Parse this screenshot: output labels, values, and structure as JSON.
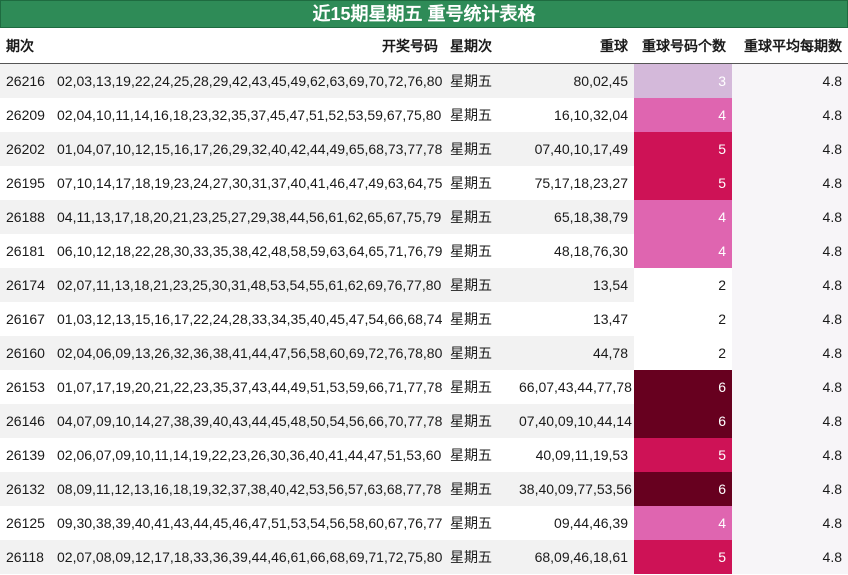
{
  "title": "近15期星期五 重号统计表格",
  "headers": {
    "period": "期次",
    "numbers": "开奖号码",
    "weekday": "星期次",
    "repeat": "重球",
    "repeat_count": "重球号码个数",
    "avg": "重球平均每期数"
  },
  "count_colors": {
    "2": "#ffffff",
    "3": "#d4b9da",
    "4": "#df65b0",
    "5": "#ce1256",
    "6": "#67001f"
  },
  "rows": [
    {
      "period": "26216",
      "numbers": "02,03,13,19,22,24,25,28,29,42,43,45,49,62,63,69,70,72,76,80",
      "weekday": "星期五",
      "repeat": "80,02,45",
      "count": "3",
      "avg": "4.8"
    },
    {
      "period": "26209",
      "numbers": "02,04,10,11,14,16,18,23,32,35,37,45,47,51,52,53,59,67,75,80",
      "weekday": "星期五",
      "repeat": "16,10,32,04",
      "count": "4",
      "avg": "4.8"
    },
    {
      "period": "26202",
      "numbers": "01,04,07,10,12,15,16,17,26,29,32,40,42,44,49,65,68,73,77,78",
      "weekday": "星期五",
      "repeat": "07,40,10,17,49",
      "count": "5",
      "avg": "4.8"
    },
    {
      "period": "26195",
      "numbers": "07,10,14,17,18,19,23,24,27,30,31,37,40,41,46,47,49,63,64,75",
      "weekday": "星期五",
      "repeat": "75,17,18,23,27",
      "count": "5",
      "avg": "4.8"
    },
    {
      "period": "26188",
      "numbers": "04,11,13,17,18,20,21,23,25,27,29,38,44,56,61,62,65,67,75,79",
      "weekday": "星期五",
      "repeat": "65,18,38,79",
      "count": "4",
      "avg": "4.8"
    },
    {
      "period": "26181",
      "numbers": "06,10,12,18,22,28,30,33,35,38,42,48,58,59,63,64,65,71,76,79",
      "weekday": "星期五",
      "repeat": "48,18,76,30",
      "count": "4",
      "avg": "4.8"
    },
    {
      "period": "26174",
      "numbers": "02,07,11,13,18,21,23,25,30,31,48,53,54,55,61,62,69,76,77,80",
      "weekday": "星期五",
      "repeat": "13,54",
      "count": "2",
      "avg": "4.8"
    },
    {
      "period": "26167",
      "numbers": "01,03,12,13,15,16,17,22,24,28,33,34,35,40,45,47,54,66,68,74",
      "weekday": "星期五",
      "repeat": "13,47",
      "count": "2",
      "avg": "4.8"
    },
    {
      "period": "26160",
      "numbers": "02,04,06,09,13,26,32,36,38,41,44,47,56,58,60,69,72,76,78,80",
      "weekday": "星期五",
      "repeat": "44,78",
      "count": "2",
      "avg": "4.8"
    },
    {
      "period": "26153",
      "numbers": "01,07,17,19,20,21,22,23,35,37,43,44,49,51,53,59,66,71,77,78",
      "weekday": "星期五",
      "repeat": "66,07,43,44,77,78",
      "count": "6",
      "avg": "4.8"
    },
    {
      "period": "26146",
      "numbers": "04,07,09,10,14,27,38,39,40,43,44,45,48,50,54,56,66,70,77,78",
      "weekday": "星期五",
      "repeat": "07,40,09,10,44,14",
      "count": "6",
      "avg": "4.8"
    },
    {
      "period": "26139",
      "numbers": "02,06,07,09,10,11,14,19,22,23,26,30,36,40,41,44,47,51,53,60",
      "weekday": "星期五",
      "repeat": "40,09,11,19,53",
      "count": "5",
      "avg": "4.8"
    },
    {
      "period": "26132",
      "numbers": "08,09,11,12,13,16,18,19,32,37,38,40,42,53,56,57,63,68,77,78",
      "weekday": "星期五",
      "repeat": "38,40,09,77,53,56",
      "count": "6",
      "avg": "4.8"
    },
    {
      "period": "26125",
      "numbers": "09,30,38,39,40,41,43,44,45,46,47,51,53,54,56,58,60,67,76,77",
      "weekday": "星期五",
      "repeat": "09,44,46,39",
      "count": "4",
      "avg": "4.8"
    },
    {
      "period": "26118",
      "numbers": "02,07,08,09,12,17,18,33,36,39,44,46,61,66,68,69,71,72,75,80",
      "weekday": "星期五",
      "repeat": "68,09,46,18,61",
      "count": "5",
      "avg": "4.8"
    }
  ]
}
